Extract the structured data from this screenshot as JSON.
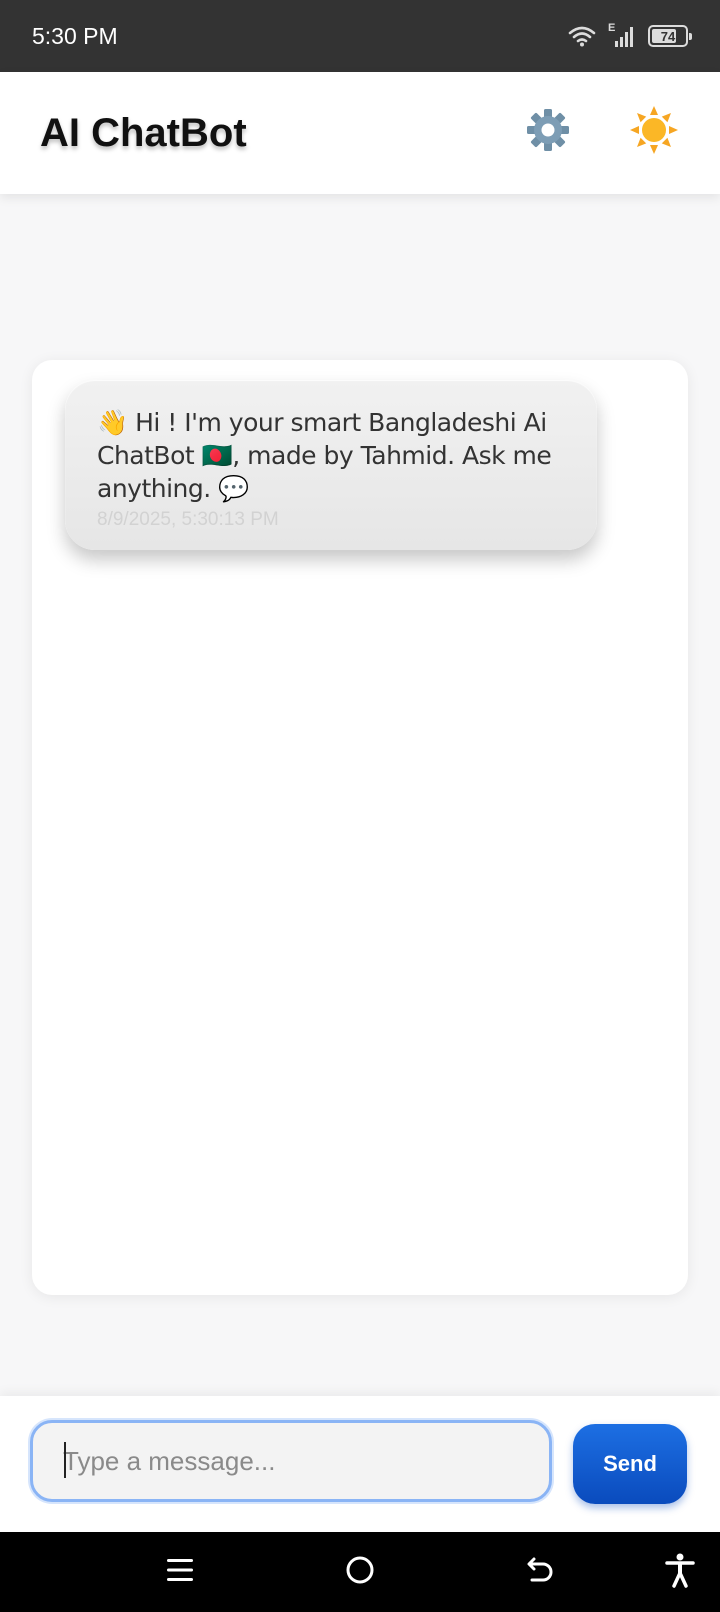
{
  "status_bar": {
    "time": "5:30 PM",
    "network_label": "E",
    "battery": "74",
    "battery_level": 0.74,
    "icons": [
      "wifi-icon",
      "signal-icon",
      "battery-icon"
    ]
  },
  "header": {
    "title": "AI ChatBot",
    "settings_icon": "gear-icon",
    "theme_icon": "sun-icon"
  },
  "chat": {
    "messages": [
      {
        "sender": "bot",
        "text": "👋 Hi ! I'm your smart Bangladeshi Ai ChatBot 🇧🇩, made by Tahmid. Ask me anything. 💬",
        "timestamp": "8/9/2025, 5:30:13 PM"
      }
    ]
  },
  "composer": {
    "placeholder": "Type a message...",
    "value": "",
    "send_label": "Send"
  },
  "nav": {
    "icons": [
      "menu-icon",
      "home-icon",
      "back-icon",
      "accessibility-icon"
    ]
  },
  "colors": {
    "status_bar": "#333333",
    "accent": "#0a4bbd",
    "input_focus": "#8ab4f5"
  }
}
